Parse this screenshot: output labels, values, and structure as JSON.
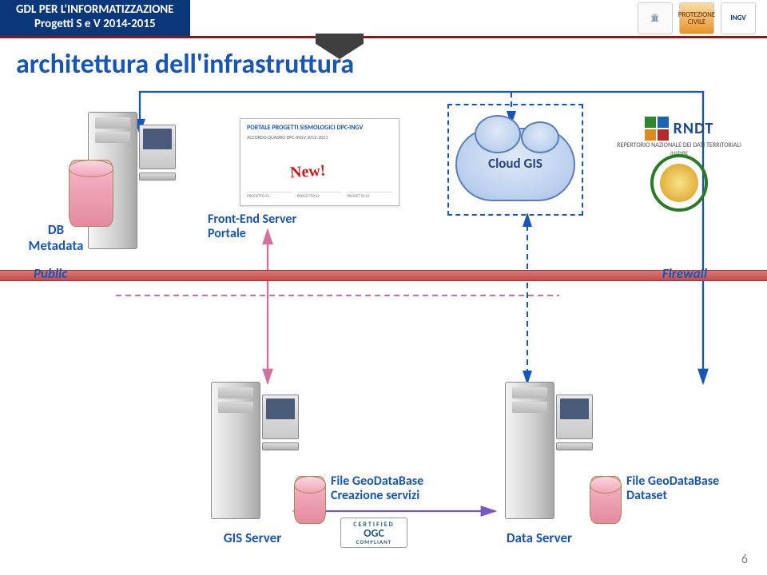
{
  "header": {
    "line1": "GDL PER L'INFORMATIZZAZIONE",
    "line2": "Progetti S e V 2014-2015",
    "logos": {
      "pc": "PROTEZIONE CIVILE",
      "ingv": "INGV"
    }
  },
  "title": "architettura dell'infrastruttura",
  "portal": {
    "title": "PORTALE PROGETTI SISMOLOGICI DPC-INGV",
    "sub": "ACCORDO QUADRO DPC-INGV 2012-2021",
    "new_badge": "New!",
    "cols": {
      "c1": "PROGETTO S1",
      "c2": "PROGETTO S2",
      "c3": "PROGETTO S3"
    }
  },
  "labels": {
    "db_metadata_l1": "DB",
    "db_metadata_l2": "Metadata",
    "frontend_l1": "Front-End Server",
    "frontend_l2": "Portale",
    "cloud": "Cloud GIS",
    "public": "Public",
    "firewall": "Firewall",
    "gis_server": "GIS Server",
    "file_gdb_l1": "File GeoDataBase",
    "file_gdb_l2": "Creazione servizi",
    "data_server": "Data Server",
    "file_gdb_ds_l1": "File GeoDataBase",
    "file_gdb_ds_l2": "Dataset"
  },
  "rndt": {
    "name": "RNDT",
    "sub": "REPERTORIO NAZIONALE DEI DATI TERRITORIALI",
    "inspire": "INSPIRE"
  },
  "ogc": {
    "top": "CERTIFIED",
    "mid": "OGC",
    "bot": "COMPLIANT"
  },
  "page": "6"
}
